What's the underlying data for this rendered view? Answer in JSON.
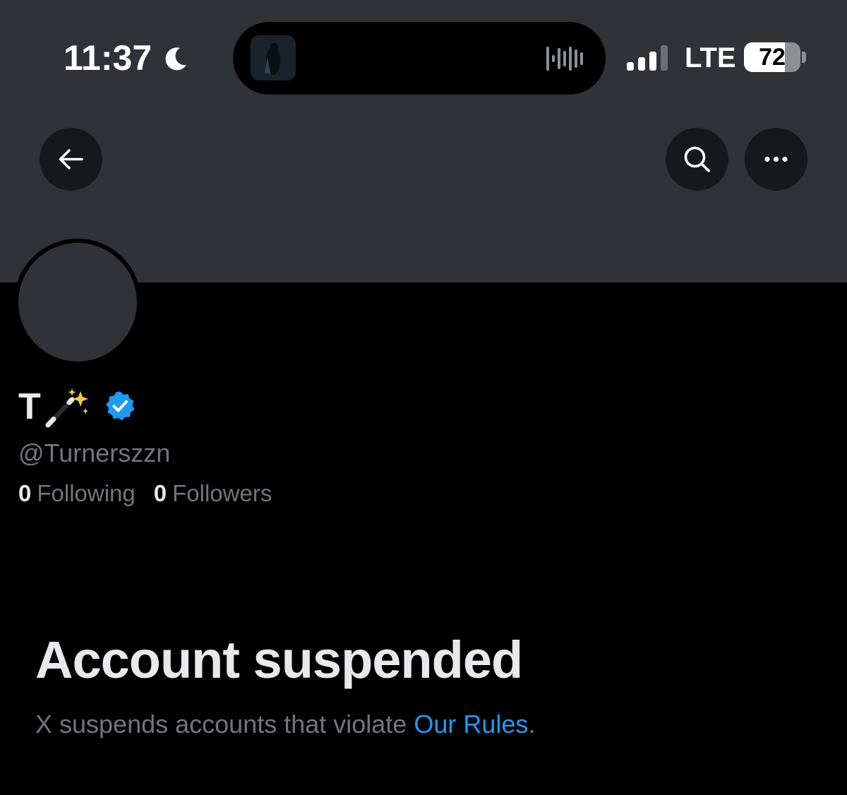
{
  "status_bar": {
    "time": "11:37",
    "network": "LTE",
    "battery": "72",
    "battery_level": 0.72,
    "icons": [
      "moon-icon",
      "waveform-icon",
      "signal-icon",
      "battery-icon"
    ]
  },
  "nav": {
    "back_icon": "arrow-left-icon",
    "search_icon": "search-icon",
    "more_icon": "more-dots-icon"
  },
  "profile": {
    "display_name": "T",
    "name_emoji": "magic-wand-icon",
    "verified_icon": "verified-badge-icon",
    "handle": "@Turnerszzn",
    "following_count": "0",
    "following_label": "Following",
    "followers_count": "0",
    "followers_label": "Followers"
  },
  "suspension": {
    "title": "Account suspended",
    "description": "X suspends accounts that violate",
    "link_text": "Our Rules",
    "trailing": "."
  },
  "colors": {
    "banner": "#2f3236",
    "background": "#000000",
    "primary_text": "#e7e9ea",
    "secondary_text": "#71767b",
    "link": "#1d9bf0",
    "verified": "#1d9bf0"
  }
}
